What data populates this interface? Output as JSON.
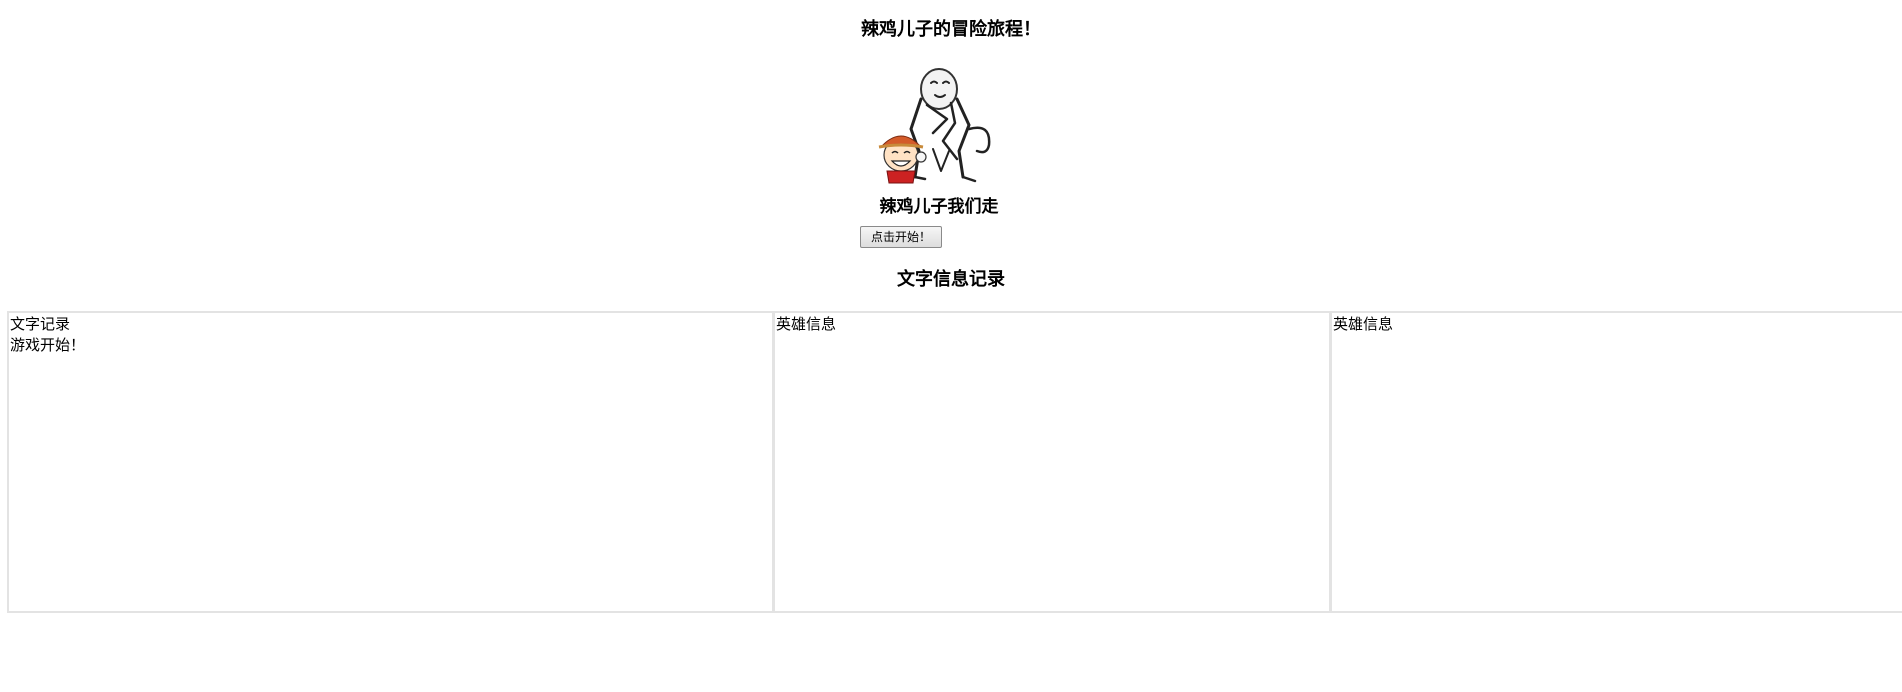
{
  "page": {
    "title": "辣鸡儿子的冒险旅程！"
  },
  "meme": {
    "caption": "辣鸡儿子我们走"
  },
  "controls": {
    "start_label": "点击开始！"
  },
  "log_section": {
    "title": "文字信息记录"
  },
  "panels": {
    "text_log": {
      "header": "文字记录",
      "entries": [
        "游戏开始！"
      ]
    },
    "hero_info_1": {
      "header": "英雄信息"
    },
    "hero_info_2": {
      "header": "英雄信息"
    }
  },
  "icons": {
    "meme_image": "panda-meme-with-cartoon-boy"
  },
  "colors": {
    "background": "#ffffff",
    "panel_border": "#e3e3e3"
  }
}
